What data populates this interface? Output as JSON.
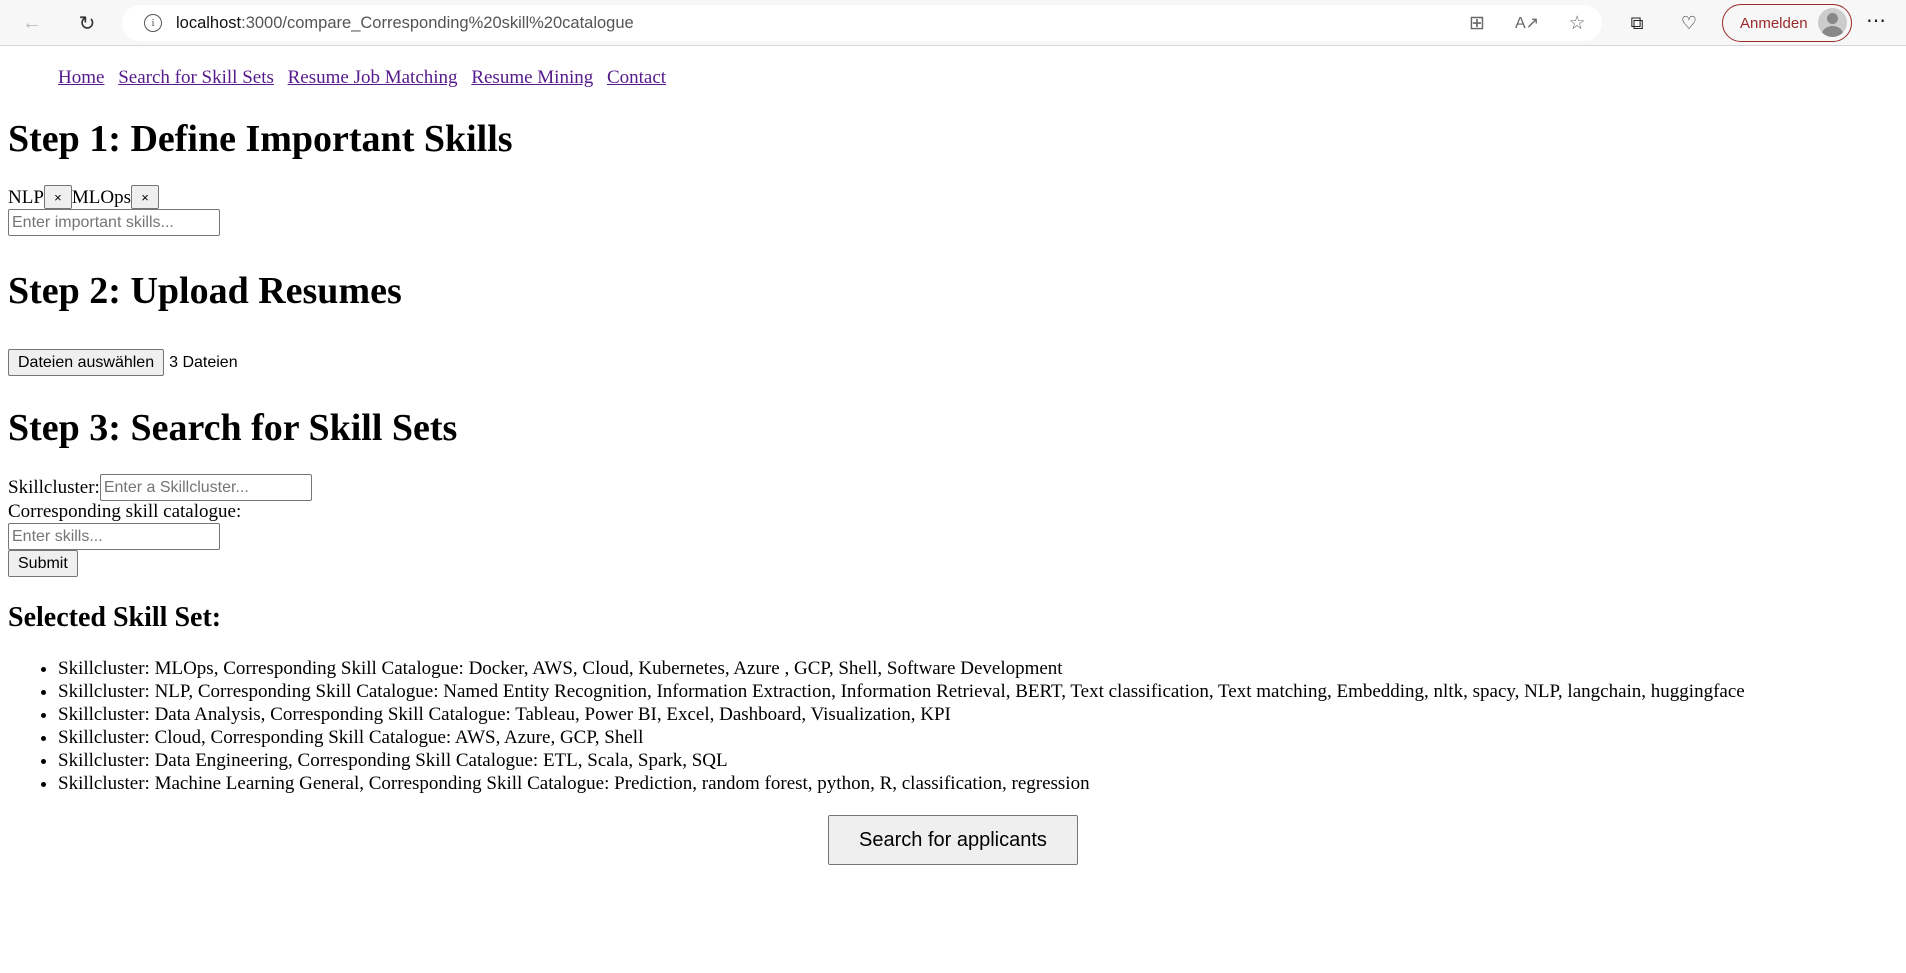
{
  "browser": {
    "url_host": "localhost",
    "url_path": ":3000/compare_Corresponding%20skill%20catalogue",
    "signin_label": "Anmelden",
    "icons": [
      "back-icon",
      "reload-icon",
      "info-icon",
      "apps-icon",
      "read-aloud-icon",
      "favorite-star-icon",
      "collections-icon",
      "browser-essentials-icon",
      "profile-avatar-icon",
      "more-icon"
    ]
  },
  "nav": {
    "links": [
      "Home",
      "Search for Skill Sets",
      "Resume Job Matching",
      "Resume Mining",
      "Contact"
    ]
  },
  "step1": {
    "title": "Step 1: Define Important Skills",
    "tags": [
      {
        "label": "NLP",
        "remove": "×"
      },
      {
        "label": "MLOps",
        "remove": "×"
      }
    ],
    "input_placeholder": "Enter important skills..."
  },
  "step2": {
    "title": "Step 2: Upload Resumes",
    "file_button": "Dateien auswählen",
    "file_status": "3 Dateien"
  },
  "step3": {
    "title": "Step 3: Search for Skill Sets",
    "skillcluster_label": "Skillcluster:",
    "skillcluster_placeholder": "Enter a Skillcluster...",
    "catalogue_label": "Corresponding skill catalogue:",
    "catalogue_placeholder": "Enter skills...",
    "submit_label": "Submit"
  },
  "selected": {
    "title": "Selected Skill Set:",
    "items": [
      "Skillcluster: MLOps, Corresponding Skill Catalogue: Docker, AWS, Cloud, Kubernetes, Azure , GCP, Shell, Software Development",
      "Skillcluster: NLP, Corresponding Skill Catalogue: Named Entity Recognition, Information Extraction, Information Retrieval, BERT, Text classification, Text matching, Embedding, nltk, spacy, NLP, langchain, huggingface",
      "Skillcluster: Data Analysis, Corresponding Skill Catalogue: Tableau, Power BI, Excel, Dashboard, Visualization, KPI",
      "Skillcluster: Cloud, Corresponding Skill Catalogue: AWS, Azure, GCP, Shell",
      "Skillcluster: Data Engineering, Corresponding Skill Catalogue: ETL, Scala, Spark, SQL",
      "Skillcluster: Machine Learning General, Corresponding Skill Catalogue: Prediction, random forest, python, R, classification, regression"
    ]
  },
  "search_button": "Search for applicants"
}
